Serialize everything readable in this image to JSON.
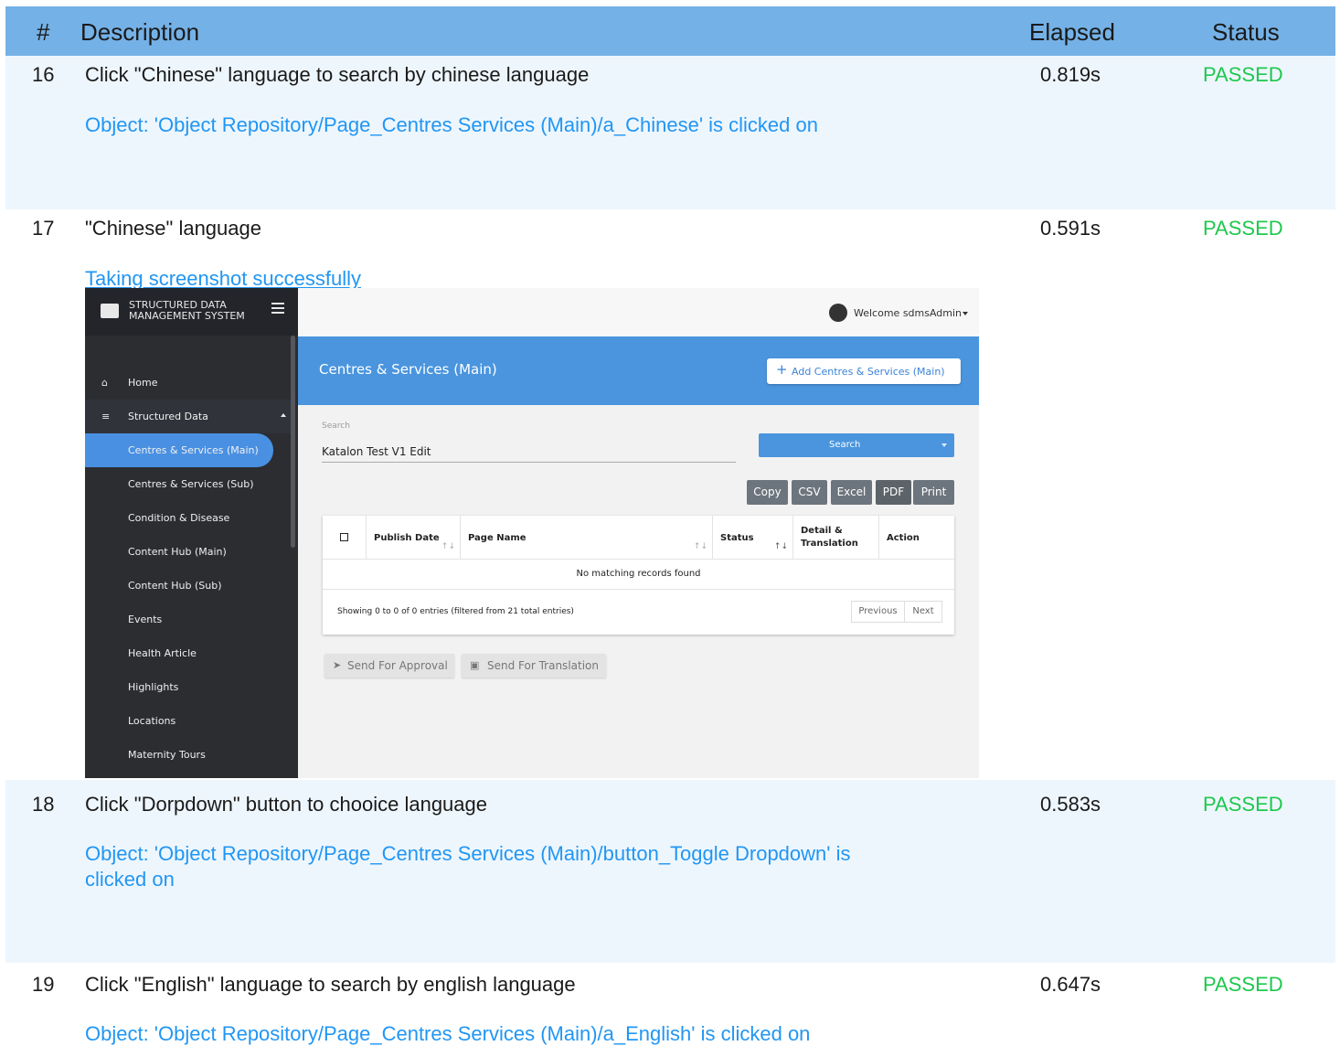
{
  "report": {
    "columns": {
      "num": "#",
      "description": "Description",
      "elapsed": "Elapsed",
      "status": "Status"
    },
    "steps": [
      {
        "num": "16",
        "description": "Click \"Chinese\" language to search by chinese language",
        "elapsed": "0.819s",
        "status": "PASSED",
        "message": "Object: 'Object Repository/Page_Centres  Services (Main)/a_Chinese' is clicked on"
      },
      {
        "num": "17",
        "description": "\"Chinese\" language",
        "elapsed": "0.591s",
        "status": "PASSED",
        "message": "Taking screenshot successfully"
      },
      {
        "num": "18",
        "description": "Click \"Dorpdown\" button to chooice language",
        "elapsed": "0.583s",
        "status": "PASSED",
        "message_line1": "Object: 'Object Repository/Page_Centres  Services (Main)/button_Toggle Dropdown' is",
        "message_line2": "clicked on"
      },
      {
        "num": "19",
        "description": "Click \"English\" language to search by english language",
        "elapsed": "0.647s",
        "status": "PASSED",
        "message": "Object: 'Object Repository/Page_Centres  Services (Main)/a_English' is clicked on"
      }
    ]
  },
  "screenshot": {
    "brand": "STRUCTURED DATA\nMANAGEMENT SYSTEM",
    "welcome": "Welcome sdmsAdmin",
    "sidebar": {
      "home": "Home",
      "structured_data": "Structured Data",
      "items": [
        "Centres & Services (Main)",
        "Centres & Services (Sub)",
        "Condition & Disease",
        "Content Hub (Main)",
        "Content Hub (Sub)",
        "Events",
        "Health Article",
        "Highlights",
        "Locations",
        "Maternity Tours"
      ]
    },
    "page_title": "Centres & Services (Main)",
    "add_button": "Add Centres & Services (Main)",
    "search": {
      "label": "Search",
      "value": "Katalon Test V1 Edit",
      "button": "Search"
    },
    "export_buttons": [
      "Copy",
      "CSV",
      "Excel",
      "PDF",
      "Print"
    ],
    "table": {
      "headers": {
        "publish_date": "Publish Date",
        "page_name": "Page Name",
        "status": "Status",
        "detail_line1": "Detail &",
        "detail_line2": "Translation",
        "action": "Action"
      },
      "empty_message": "No matching records found",
      "info": "Showing 0 to 0 of 0 entries (filtered from 21 total entries)",
      "previous": "Previous",
      "next": "Next"
    },
    "send_approval": "Send For Approval",
    "send_translation": "Send For Translation"
  },
  "colors": {
    "header_blue": "#74b1e6",
    "passed_green": "#1ec84e",
    "message_blue": "#2196f3",
    "accent": "#4a95de"
  }
}
